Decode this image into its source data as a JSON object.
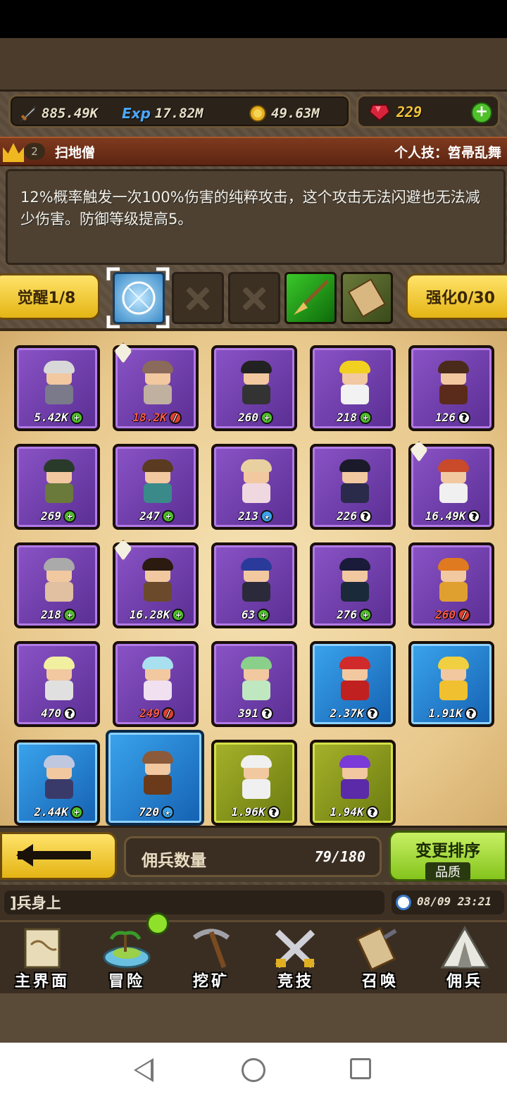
{
  "resources": {
    "power": "885.49K",
    "exp_label": "Exp",
    "exp": "17.82M",
    "gold": "49.63M",
    "gems": "229"
  },
  "hero": {
    "level": "2",
    "name": "扫地僧",
    "skill": "个人技：笤帚乱舞",
    "description": "12%概率触发一次100%伤害的纯粹攻击，这个攻击无法闪避也无法减少伤害。防御等级提高5。"
  },
  "awaken": {
    "label": "觉醒1/8"
  },
  "enhance": {
    "label": "强化0/30"
  },
  "mercenaries": [
    {
      "count": "5.42K",
      "badge": "plus",
      "rarity": "purple"
    },
    {
      "count": "18.2K",
      "badge": "no",
      "rarity": "purple",
      "red": true,
      "tag": true
    },
    {
      "count": "260",
      "badge": "plus",
      "rarity": "purple"
    },
    {
      "count": "218",
      "badge": "plus",
      "rarity": "purple"
    },
    {
      "count": "126",
      "badge": "q",
      "rarity": "purple"
    },
    {
      "count": "269",
      "badge": "plus",
      "rarity": "purple"
    },
    {
      "count": "247",
      "badge": "plus",
      "rarity": "purple"
    },
    {
      "count": "213",
      "badge": "star",
      "rarity": "purple"
    },
    {
      "count": "226",
      "badge": "q",
      "rarity": "purple"
    },
    {
      "count": "16.49K",
      "badge": "q",
      "rarity": "purple",
      "tag": true
    },
    {
      "count": "218",
      "badge": "plus",
      "rarity": "purple"
    },
    {
      "count": "16.28K",
      "badge": "plus",
      "rarity": "purple",
      "tag": true
    },
    {
      "count": "63",
      "badge": "plus",
      "rarity": "purple"
    },
    {
      "count": "276",
      "badge": "plus",
      "rarity": "purple"
    },
    {
      "count": "260",
      "badge": "no",
      "rarity": "purple",
      "red": true
    },
    {
      "count": "470",
      "badge": "q",
      "rarity": "purple"
    },
    {
      "count": "249",
      "badge": "no",
      "rarity": "purple",
      "red": true
    },
    {
      "count": "391",
      "badge": "q",
      "rarity": "purple"
    },
    {
      "count": "2.37K",
      "badge": "q",
      "rarity": "blue"
    },
    {
      "count": "1.91K",
      "badge": "q",
      "rarity": "blue"
    },
    {
      "count": "2.44K",
      "badge": "plus",
      "rarity": "blue"
    },
    {
      "count": "720",
      "badge": "star",
      "rarity": "blue",
      "selected": true
    },
    {
      "count": "1.96K",
      "badge": "q",
      "rarity": "olive"
    },
    {
      "count": "1.94K",
      "badge": "q",
      "rarity": "olive"
    }
  ],
  "mercenary_count": {
    "label": "佣兵数量",
    "value": "79/180"
  },
  "sort": {
    "label": "变更排序",
    "mode": "品质"
  },
  "message": "]兵身上",
  "datetime": "08/09 23:21",
  "nav": [
    "主界面",
    "冒险",
    "挖矿",
    "竞技",
    "召唤",
    "佣兵"
  ],
  "colors": {
    "gold": "#f2c33a",
    "accent_green": "#84c41c",
    "panel": "#e8c88c"
  }
}
